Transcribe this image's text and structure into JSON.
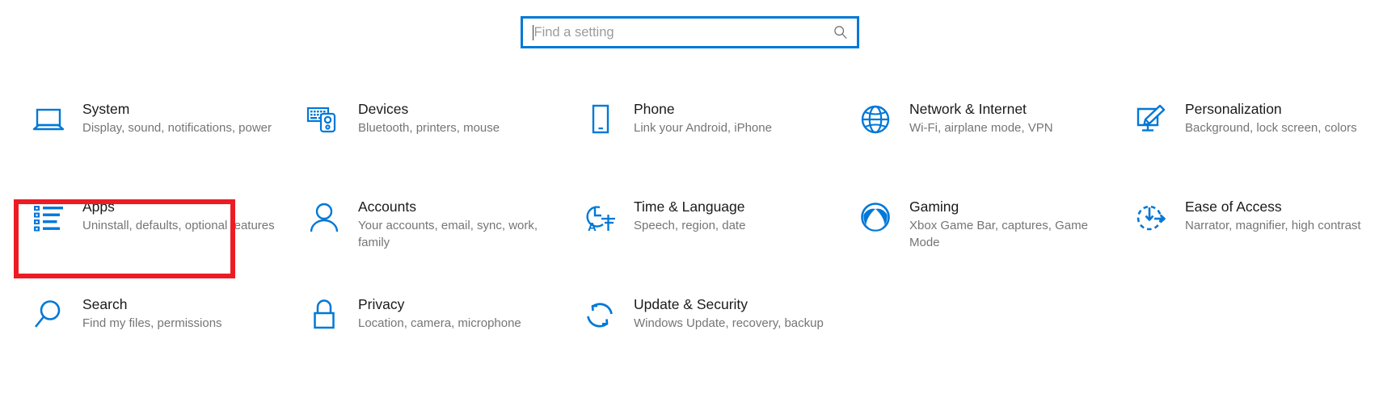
{
  "search": {
    "placeholder": "Find a setting",
    "value": "",
    "icon": "search-icon",
    "border_color": "#0078D7"
  },
  "accent_color": "#0078D7",
  "highlight": {
    "target": "Apps",
    "color": "#ED1C24"
  },
  "tiles": [
    {
      "title": "System",
      "desc": "Display, sound, notifications, power",
      "icon": "laptop-icon"
    },
    {
      "title": "Devices",
      "desc": "Bluetooth, printers, mouse",
      "icon": "keyboard-mouse-icon"
    },
    {
      "title": "Phone",
      "desc": "Link your Android, iPhone",
      "icon": "phone-icon"
    },
    {
      "title": "Network & Internet",
      "desc": "Wi-Fi, airplane mode, VPN",
      "icon": "globe-icon"
    },
    {
      "title": "Personalization",
      "desc": "Background, lock screen, colors",
      "icon": "monitor-brush-icon"
    },
    {
      "title": "Apps",
      "desc": "Uninstall, defaults, optional features",
      "icon": "app-list-icon"
    },
    {
      "title": "Accounts",
      "desc": "Your accounts, email, sync, work, family",
      "icon": "person-icon"
    },
    {
      "title": "Time & Language",
      "desc": "Speech, region, date",
      "icon": "clock-language-icon"
    },
    {
      "title": "Gaming",
      "desc": "Xbox Game Bar, captures, Game Mode",
      "icon": "xbox-icon"
    },
    {
      "title": "Ease of Access",
      "desc": "Narrator, magnifier, high contrast",
      "icon": "accessibility-clock-icon"
    },
    {
      "title": "Search",
      "desc": "Find my files, permissions",
      "icon": "magnifier-icon"
    },
    {
      "title": "Privacy",
      "desc": "Location, camera, microphone",
      "icon": "lock-icon"
    },
    {
      "title": "Update & Security",
      "desc": "Windows Update, recovery, backup",
      "icon": "refresh-icon"
    }
  ]
}
